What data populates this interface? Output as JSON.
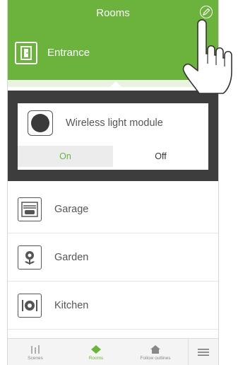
{
  "header": {
    "title": "Rooms"
  },
  "active_room": {
    "label": "Entrance",
    "icon": "door-icon"
  },
  "device": {
    "name": "Wireless light module",
    "icon": "light-module-icon",
    "on_label": "On",
    "off_label": "Off",
    "state": "On"
  },
  "rooms": [
    {
      "label": "Garage",
      "icon": "garage-icon"
    },
    {
      "label": "Garden",
      "icon": "flower-icon"
    },
    {
      "label": "Kitchen",
      "icon": "kitchen-icon"
    }
  ],
  "tabs": [
    {
      "label": "Scenes",
      "icon": "scenes-icon"
    },
    {
      "label": "Rooms",
      "icon": "rooms-icon"
    },
    {
      "label": "Follow outlines",
      "icon": "house-icon"
    }
  ],
  "colors": {
    "accent": "#6cb33e",
    "panel": "#3d3d3d"
  }
}
